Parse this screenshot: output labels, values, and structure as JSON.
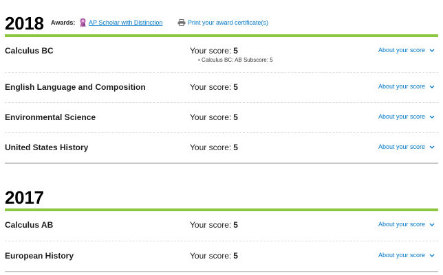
{
  "years": [
    {
      "year": "2018",
      "awards_label": "Awards:",
      "award_name": "AP Scholar with Distinction",
      "print_label": "Print your award certificate(s)",
      "courses": [
        {
          "name": "Calculus BC",
          "score_label": "Your score:",
          "score": "5",
          "subscore_bullet": "•",
          "subscore": "Calculus BC: AB Subscore: 5",
          "about": "About your score"
        },
        {
          "name": "English Language and Composition",
          "score_label": "Your score:",
          "score": "5",
          "about": "About your score"
        },
        {
          "name": "Environmental Science",
          "score_label": "Your score:",
          "score": "5",
          "about": "About your score"
        },
        {
          "name": "United States History",
          "score_label": "Your score:",
          "score": "5",
          "about": "About your score"
        }
      ]
    },
    {
      "year": "2017",
      "courses": [
        {
          "name": "Calculus AB",
          "score_label": "Your score:",
          "score": "5",
          "about": "About your score"
        },
        {
          "name": "European History",
          "score_label": "Your score:",
          "score": "5",
          "about": "About your score"
        }
      ]
    }
  ],
  "colors": {
    "accent_green": "#8dc63f",
    "link_blue": "#0077c8",
    "award_ribbon": "#b05fa8"
  },
  "icons": {
    "award": "ribbon-medal-icon",
    "print": "printer-icon",
    "expand": "chevron-down-icon"
  }
}
